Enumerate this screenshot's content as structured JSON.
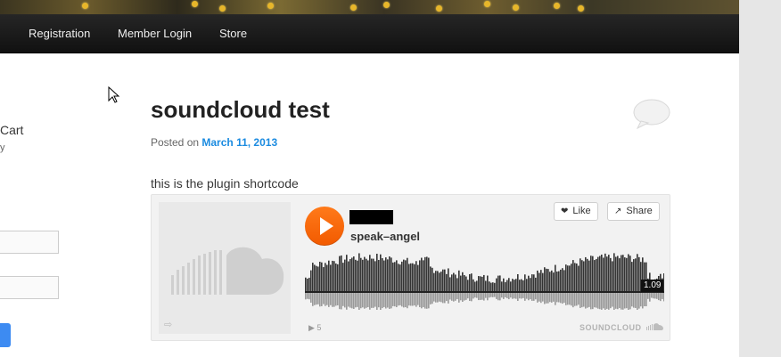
{
  "nav": {
    "items": [
      {
        "label": "Registration"
      },
      {
        "label": "Member Login"
      },
      {
        "label": "Store"
      }
    ]
  },
  "sidebar": {
    "cart_label": "Cart",
    "cart_sub": "y"
  },
  "post": {
    "title": "soundcloud test",
    "posted_prefix": "Posted on",
    "date": "March 11, 2013",
    "body": "this is the plugin shortcode"
  },
  "player": {
    "track_name": "speak–angel",
    "like_label": "Like",
    "share_label": "Share",
    "elapsed": "1.09",
    "play_count": "5",
    "brand": "SOUNDCLOUD",
    "colors": {
      "play": "#ff6a00",
      "wave_upper": "#333333",
      "wave_lower": "#999999"
    }
  },
  "icons": {
    "play": "play-icon",
    "like": "heart-icon",
    "share": "share-icon",
    "comment": "comment-bubble-icon",
    "cursor": "mouse-cursor-icon"
  },
  "colors": {
    "nav_bg": "#1a1a1a",
    "link": "#1b8be0",
    "accent_orange": "#f26a10"
  }
}
